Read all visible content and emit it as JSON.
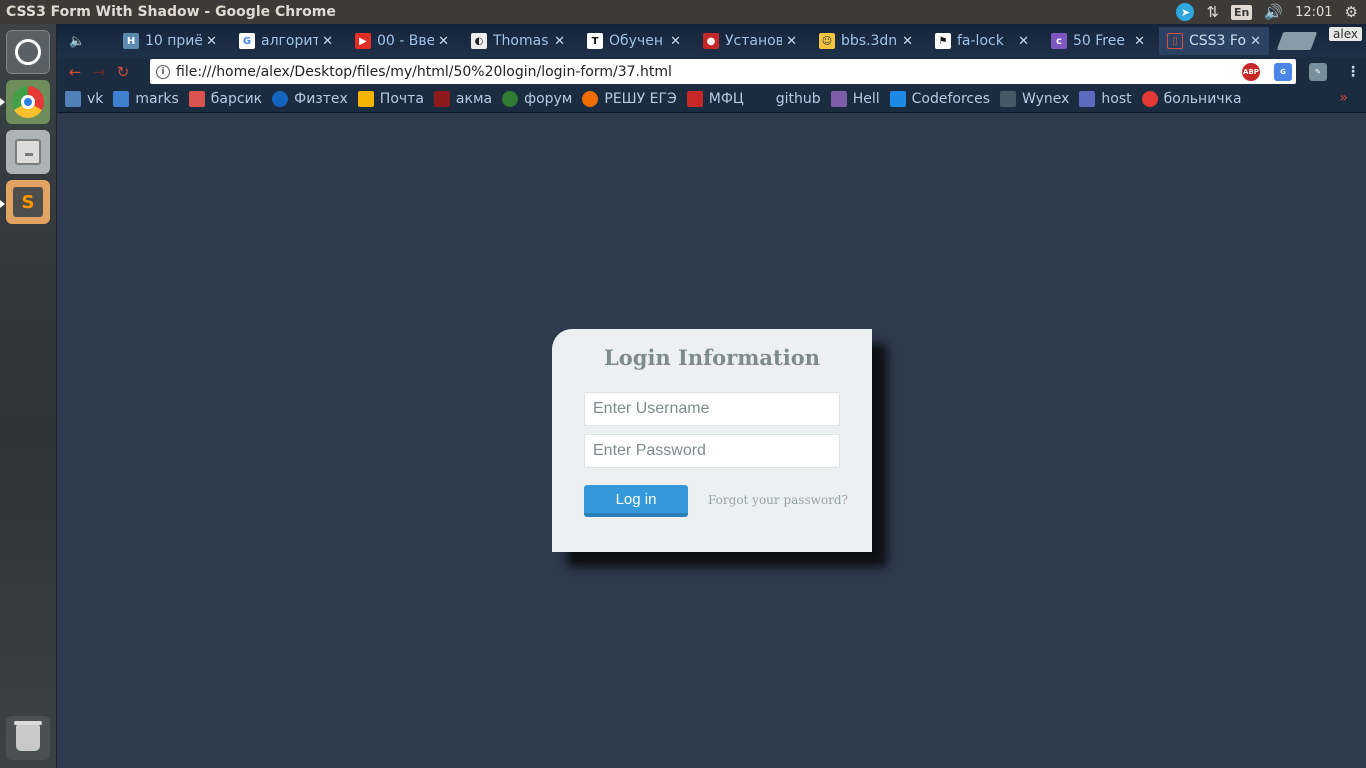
{
  "system": {
    "window_title": "CSS3 Form With Shadow - Google Chrome",
    "tray": {
      "telegram_icon": "telegram-icon",
      "network_icon": "updown-arrows-icon",
      "keyboard_layout": "En",
      "volume_icon": "speaker-icon",
      "clock": "12:01",
      "settings_icon": "gear-icon"
    }
  },
  "launcher": {
    "items": [
      "dash-home",
      "google-chrome",
      "files",
      "sublime-text",
      "trash"
    ]
  },
  "browser": {
    "profile_name": "alex",
    "tabs": [
      {
        "label": "10 приё",
        "favicon": "H",
        "color": "#5b8bb0"
      },
      {
        "label": "алгорит",
        "favicon": "G",
        "color": "#4285f4"
      },
      {
        "label": "00 - Вве",
        "favicon": "▶",
        "color": "#e52d27"
      },
      {
        "label": "Thomas",
        "favicon": "◐",
        "color": "#222222"
      },
      {
        "label": "Обучен",
        "favicon": "T",
        "color": "#ffffff"
      },
      {
        "label": "Установ",
        "favicon": "●",
        "color": "#c62828"
      },
      {
        "label": "bbs.3dn",
        "favicon": "☺",
        "color": "#f5c542"
      },
      {
        "label": "fa-lock",
        "favicon": "⚑",
        "color": "#111111"
      },
      {
        "label": "50 Free",
        "favicon": "c",
        "color": "#7e57c2"
      },
      {
        "label": "CSS3 Fo",
        "favicon": "▯",
        "color": "#2b4262",
        "active": true
      }
    ],
    "url": "file:///home/alex/Desktop/files/my/html/50%20login/login-form/37.html",
    "extensions": [
      "ABP",
      "G",
      "tool"
    ],
    "bookmarks": [
      {
        "label": "vk",
        "color": "#5181b8"
      },
      {
        "label": "marks",
        "color": "#3f7fd0"
      },
      {
        "label": "барсик",
        "color": "#d9534f"
      },
      {
        "label": "Физтех",
        "color": "#1565c0"
      },
      {
        "label": "Почта",
        "color": "#f5b400"
      },
      {
        "label": "акма",
        "color": "#8e1b1b"
      },
      {
        "label": "форум",
        "color": "#2e7d32"
      },
      {
        "label": "РЕШУ ЕГЭ",
        "color": "#ef6c00"
      },
      {
        "label": "МФЦ",
        "color": "#c62828"
      },
      {
        "label": "github",
        "color": "#1b2b40"
      },
      {
        "label": "Hell",
        "color": "#7b5ea7"
      },
      {
        "label": "Codeforces",
        "color": "#1e88e5"
      },
      {
        "label": "Wynex",
        "color": "#455a64"
      },
      {
        "label": "host",
        "color": "#5c6bc0"
      },
      {
        "label": "больничка",
        "color": "#e53935"
      }
    ]
  },
  "page": {
    "title": "Login Information",
    "username_placeholder": "Enter Username",
    "password_placeholder": "Enter Password",
    "login_button": "Log in",
    "forgot_link": "Forgot your password?"
  }
}
